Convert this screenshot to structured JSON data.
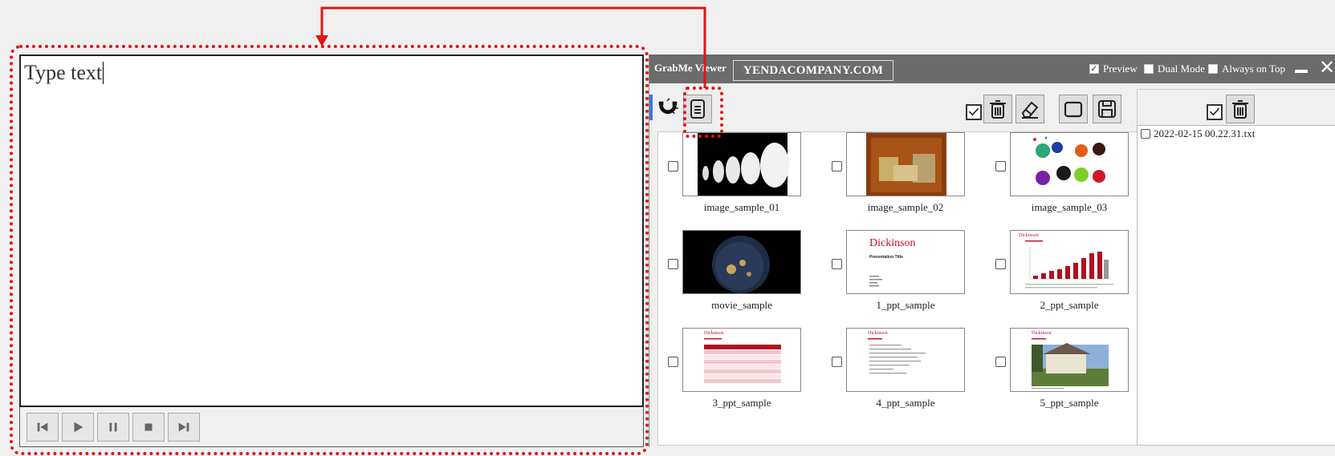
{
  "editor": {
    "text": "Type text"
  },
  "controls": {
    "items": [
      "prev-track",
      "play",
      "pause",
      "stop",
      "next-track"
    ]
  },
  "viewer": {
    "app_title": "GrabMe Viewer",
    "site": "YENDACOMPANY.COM",
    "options": [
      {
        "label": "Preview",
        "checked": true
      },
      {
        "label": "Dual Mode",
        "checked": false
      },
      {
        "label": "Always on Top",
        "checked": false
      }
    ]
  },
  "gallery": {
    "items": [
      {
        "caption": "image_sample_01",
        "thumb": "spheres"
      },
      {
        "caption": "image_sample_02",
        "thumb": "rust"
      },
      {
        "caption": "image_sample_03",
        "thumb": "paint"
      },
      {
        "caption": "movie_sample",
        "thumb": "earth"
      },
      {
        "caption": "1_ppt_sample",
        "thumb": "ppt-title"
      },
      {
        "caption": "2_ppt_sample",
        "thumb": "ppt-chart"
      },
      {
        "caption": "3_ppt_sample",
        "thumb": "ppt-table"
      },
      {
        "caption": "4_ppt_sample",
        "thumb": "ppt-list"
      },
      {
        "caption": "5_ppt_sample",
        "thumb": "ppt-photo"
      }
    ]
  },
  "ppt": {
    "brand": "Dickinson",
    "presentation_title": "Presentation Title"
  },
  "files": {
    "items": [
      {
        "name": "2022-02-15 00.22.31.txt",
        "checked": false
      }
    ]
  },
  "colors": {
    "annotation": "#e01515",
    "titlebar": "#6c6c6c",
    "accent": "#c8102e"
  }
}
